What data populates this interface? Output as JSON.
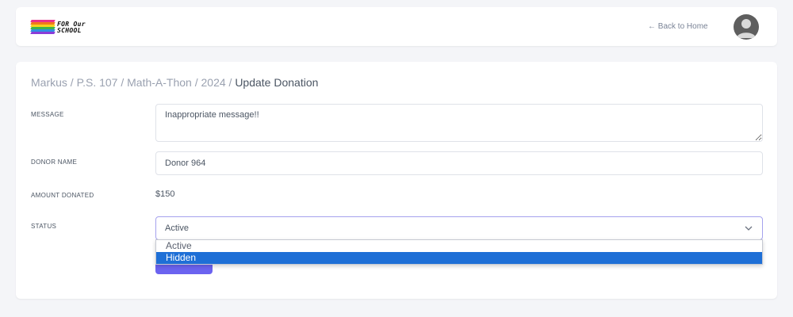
{
  "header": {
    "logo_line1": "FOR Our",
    "logo_line2": "SCHOOL",
    "back_link": "← Back to Home"
  },
  "breadcrumb": {
    "trail": "Markus / P.S. 107 / Math-A-Thon / 2024 / ",
    "current": "Update Donation"
  },
  "form": {
    "message_label": "MESSAGE",
    "message_value": "Inappropriate message!!",
    "donor_label": "DONOR NAME",
    "donor_value": "Donor 964",
    "amount_label": "AMOUNT DONATED",
    "amount_value": "$150",
    "status_label": "STATUS",
    "status_value": "Active",
    "status_options": [
      "Active",
      "Hidden"
    ],
    "highlighted_option": "Hidden"
  },
  "colors": {
    "accent": "#6b63f0",
    "highlight": "#1e6fd6"
  }
}
